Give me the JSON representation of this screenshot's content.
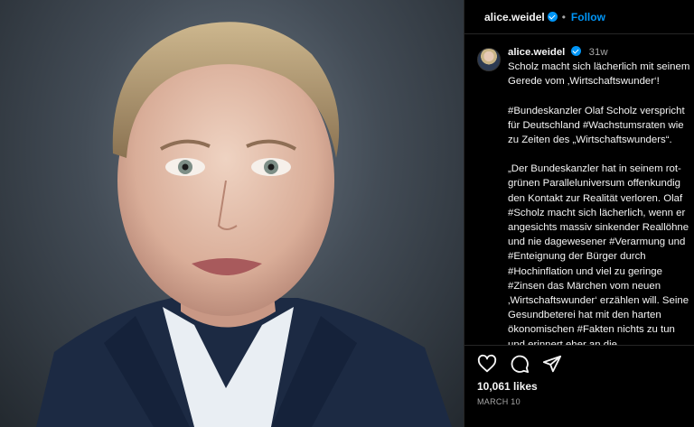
{
  "post": {
    "username": "alice.weidel",
    "follow_label": "Follow",
    "time_ago": "31w",
    "caption_lines": [
      "Scholz macht sich lächerlich mit seinem",
      "Gerede vom ‚Wirtschaftswunder‘!",
      "",
      "#Bundeskanzler Olaf Scholz verspricht",
      "für Deutschland #Wachstumsraten wie",
      "zu Zeiten des „Wirtschaftswunders“.",
      "",
      "„Der Bundeskanzler hat in seinem rot-",
      "grünen Paralleluniversum offenkundig",
      "den Kontakt zur Realität verloren. Olaf",
      "#Scholz macht sich lächerlich, wenn er",
      "angesichts massiv sinkender Reallöhne",
      "und nie dagewesener #Verarmung und",
      "#Enteignung der Bürger durch",
      "#Hochinflation und viel zu geringe",
      "#Zinsen das Märchen vom neuen",
      "‚Wirtschaftswunder‘ erzählen will. Seine",
      "Gesundbeterei hat mit den harten",
      "ökonomischen #Fakten nichts zu tun",
      "und erinnert eher an die"
    ],
    "likes": "10,061 likes",
    "date": "MARCH 10"
  },
  "icons": {
    "like": "heart-icon",
    "comment": "comment-icon",
    "share": "paper-plane-icon",
    "verified": "verified-badge-icon"
  },
  "colors": {
    "background": "#000000",
    "link": "#0095f6",
    "muted": "#a8a8a8"
  }
}
